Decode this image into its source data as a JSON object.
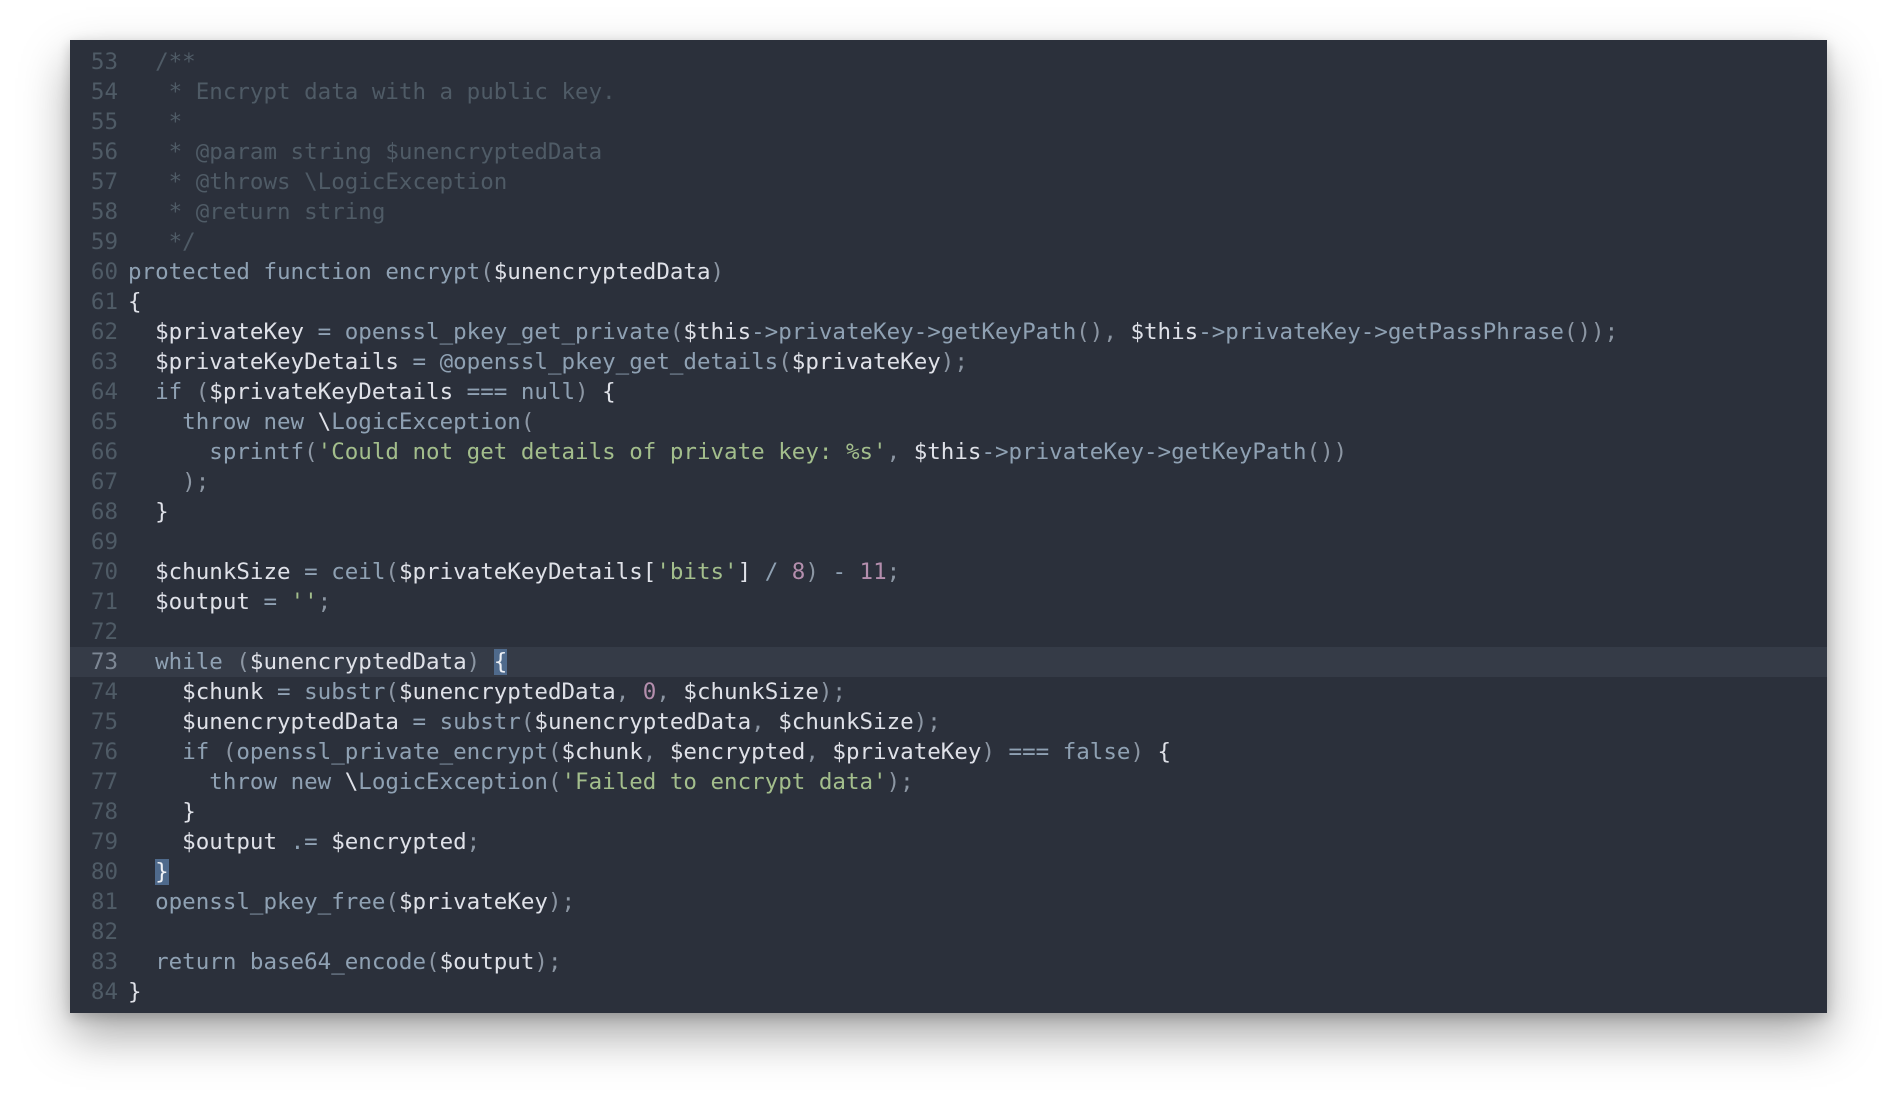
{
  "editor": {
    "colors": {
      "background": "#2b303b",
      "active_line": "#353b47",
      "bracket_match": "#4f6a8c",
      "comment": "#4f5b66",
      "keyword": "#8fa1b3",
      "string": "#a3be8c",
      "number": "#b48ead",
      "variable": "#dfe1e8"
    },
    "active_line_number": "73",
    "lines": [
      {
        "n": "53",
        "tokens": [
          [
            "cm",
            "  /**"
          ]
        ]
      },
      {
        "n": "54",
        "tokens": [
          [
            "cm",
            "   * Encrypt data with a public key."
          ]
        ]
      },
      {
        "n": "55",
        "tokens": [
          [
            "cm",
            "   *"
          ]
        ]
      },
      {
        "n": "56",
        "tokens": [
          [
            "cm",
            "   * @param string $unencryptedData"
          ]
        ]
      },
      {
        "n": "57",
        "tokens": [
          [
            "cm",
            "   * @throws \\LogicException"
          ]
        ]
      },
      {
        "n": "58",
        "tokens": [
          [
            "cm",
            "   * @return string"
          ]
        ]
      },
      {
        "n": "59",
        "tokens": [
          [
            "cm",
            "   */"
          ]
        ]
      },
      {
        "n": "60",
        "tokens": [
          [
            "kw",
            "protected"
          ],
          [
            "vr",
            " "
          ],
          [
            "kw",
            "function"
          ],
          [
            "vr",
            " "
          ],
          [
            "fn",
            "encrypt"
          ],
          [
            "pu",
            "("
          ],
          [
            "vr",
            "$unencryptedData"
          ],
          [
            "pu",
            ")"
          ]
        ]
      },
      {
        "n": "61",
        "tokens": [
          [
            "br",
            "{"
          ]
        ]
      },
      {
        "n": "62",
        "tokens": [
          [
            "vr",
            "  $privateKey "
          ],
          [
            "op",
            "="
          ],
          [
            "vr",
            " "
          ],
          [
            "fn",
            "openssl_pkey_get_private"
          ],
          [
            "pu",
            "("
          ],
          [
            "vr",
            "$this"
          ],
          [
            "op",
            "->"
          ],
          [
            "fn",
            "privateKey"
          ],
          [
            "op",
            "->"
          ],
          [
            "fn",
            "getKeyPath"
          ],
          [
            "pu",
            "(), "
          ],
          [
            "vr",
            "$this"
          ],
          [
            "op",
            "->"
          ],
          [
            "fn",
            "privateKey"
          ],
          [
            "op",
            "->"
          ],
          [
            "fn",
            "getPassPhrase"
          ],
          [
            "pu",
            "());"
          ]
        ]
      },
      {
        "n": "63",
        "tokens": [
          [
            "vr",
            "  $privateKeyDetails "
          ],
          [
            "op",
            "="
          ],
          [
            "vr",
            " "
          ],
          [
            "op",
            "@"
          ],
          [
            "fn",
            "openssl_pkey_get_details"
          ],
          [
            "pu",
            "("
          ],
          [
            "vr",
            "$privateKey"
          ],
          [
            "pu",
            ");"
          ]
        ]
      },
      {
        "n": "64",
        "tokens": [
          [
            "vr",
            "  "
          ],
          [
            "kw",
            "if"
          ],
          [
            "vr",
            " "
          ],
          [
            "pu",
            "("
          ],
          [
            "vr",
            "$privateKeyDetails "
          ],
          [
            "op",
            "==="
          ],
          [
            "vr",
            " "
          ],
          [
            "kw",
            "null"
          ],
          [
            "pu",
            ")"
          ],
          [
            "vr",
            " "
          ],
          [
            "br",
            "{"
          ]
        ]
      },
      {
        "n": "65",
        "tokens": [
          [
            "vr",
            "    "
          ],
          [
            "kw",
            "throw"
          ],
          [
            "vr",
            " "
          ],
          [
            "kw",
            "new"
          ],
          [
            "vr",
            " \\"
          ],
          [
            "fn",
            "LogicException"
          ],
          [
            "pu",
            "("
          ]
        ]
      },
      {
        "n": "66",
        "tokens": [
          [
            "vr",
            "      "
          ],
          [
            "fn",
            "sprintf"
          ],
          [
            "pu",
            "("
          ],
          [
            "st",
            "'Could not get details of private key: %s'"
          ],
          [
            "pu",
            ", "
          ],
          [
            "vr",
            "$this"
          ],
          [
            "op",
            "->"
          ],
          [
            "fn",
            "privateKey"
          ],
          [
            "op",
            "->"
          ],
          [
            "fn",
            "getKeyPath"
          ],
          [
            "pu",
            "())"
          ]
        ]
      },
      {
        "n": "67",
        "tokens": [
          [
            "vr",
            "    "
          ],
          [
            "pu",
            ");"
          ]
        ]
      },
      {
        "n": "68",
        "tokens": [
          [
            "vr",
            "  "
          ],
          [
            "br",
            "}"
          ]
        ]
      },
      {
        "n": "69",
        "tokens": []
      },
      {
        "n": "70",
        "tokens": [
          [
            "vr",
            "  $chunkSize "
          ],
          [
            "op",
            "="
          ],
          [
            "vr",
            " "
          ],
          [
            "fn",
            "ceil"
          ],
          [
            "pu",
            "("
          ],
          [
            "vr",
            "$privateKeyDetails["
          ],
          [
            "st",
            "'bits'"
          ],
          [
            "vr",
            "] "
          ],
          [
            "op",
            "/"
          ],
          [
            "vr",
            " "
          ],
          [
            "nu",
            "8"
          ],
          [
            "pu",
            ")"
          ],
          [
            "vr",
            " "
          ],
          [
            "op",
            "-"
          ],
          [
            "vr",
            " "
          ],
          [
            "nu",
            "11"
          ],
          [
            "pu",
            ";"
          ]
        ]
      },
      {
        "n": "71",
        "tokens": [
          [
            "vr",
            "  $output "
          ],
          [
            "op",
            "="
          ],
          [
            "vr",
            " "
          ],
          [
            "st",
            "''"
          ],
          [
            "pu",
            ";"
          ]
        ]
      },
      {
        "n": "72",
        "tokens": []
      },
      {
        "n": "73",
        "tokens": [
          [
            "vr",
            "  "
          ],
          [
            "kw",
            "while"
          ],
          [
            "vr",
            " "
          ],
          [
            "pu",
            "("
          ],
          [
            "vr",
            "$unencryptedData"
          ],
          [
            "pu",
            ")"
          ],
          [
            "vr",
            " "
          ],
          [
            "hl",
            "{"
          ]
        ]
      },
      {
        "n": "74",
        "tokens": [
          [
            "vr",
            "    $chunk "
          ],
          [
            "op",
            "="
          ],
          [
            "vr",
            " "
          ],
          [
            "fn",
            "substr"
          ],
          [
            "pu",
            "("
          ],
          [
            "vr",
            "$unencryptedData"
          ],
          [
            "pu",
            ", "
          ],
          [
            "nu",
            "0"
          ],
          [
            "pu",
            ", "
          ],
          [
            "vr",
            "$chunkSize"
          ],
          [
            "pu",
            ");"
          ]
        ]
      },
      {
        "n": "75",
        "tokens": [
          [
            "vr",
            "    $unencryptedData "
          ],
          [
            "op",
            "="
          ],
          [
            "vr",
            " "
          ],
          [
            "fn",
            "substr"
          ],
          [
            "pu",
            "("
          ],
          [
            "vr",
            "$unencryptedData"
          ],
          [
            "pu",
            ", "
          ],
          [
            "vr",
            "$chunkSize"
          ],
          [
            "pu",
            ");"
          ]
        ]
      },
      {
        "n": "76",
        "tokens": [
          [
            "vr",
            "    "
          ],
          [
            "kw",
            "if"
          ],
          [
            "vr",
            " "
          ],
          [
            "pu",
            "("
          ],
          [
            "fn",
            "openssl_private_encrypt"
          ],
          [
            "pu",
            "("
          ],
          [
            "vr",
            "$chunk"
          ],
          [
            "pu",
            ", "
          ],
          [
            "vr",
            "$encrypted"
          ],
          [
            "pu",
            ", "
          ],
          [
            "vr",
            "$privateKey"
          ],
          [
            "pu",
            ")"
          ],
          [
            "vr",
            " "
          ],
          [
            "op",
            "==="
          ],
          [
            "vr",
            " "
          ],
          [
            "kw",
            "false"
          ],
          [
            "pu",
            ")"
          ],
          [
            "vr",
            " "
          ],
          [
            "br",
            "{"
          ]
        ]
      },
      {
        "n": "77",
        "tokens": [
          [
            "vr",
            "      "
          ],
          [
            "kw",
            "throw"
          ],
          [
            "vr",
            " "
          ],
          [
            "kw",
            "new"
          ],
          [
            "vr",
            " \\"
          ],
          [
            "fn",
            "LogicException"
          ],
          [
            "pu",
            "("
          ],
          [
            "st",
            "'Failed to encrypt data'"
          ],
          [
            "pu",
            ");"
          ]
        ]
      },
      {
        "n": "78",
        "tokens": [
          [
            "vr",
            "    "
          ],
          [
            "br",
            "}"
          ]
        ]
      },
      {
        "n": "79",
        "tokens": [
          [
            "vr",
            "    $output "
          ],
          [
            "op",
            ".="
          ],
          [
            "vr",
            " $encrypted"
          ],
          [
            "pu",
            ";"
          ]
        ]
      },
      {
        "n": "80",
        "tokens": [
          [
            "vr",
            "  "
          ],
          [
            "hl",
            "}"
          ]
        ]
      },
      {
        "n": "81",
        "tokens": [
          [
            "vr",
            "  "
          ],
          [
            "fn",
            "openssl_pkey_free"
          ],
          [
            "pu",
            "("
          ],
          [
            "vr",
            "$privateKey"
          ],
          [
            "pu",
            ");"
          ]
        ]
      },
      {
        "n": "82",
        "tokens": []
      },
      {
        "n": "83",
        "tokens": [
          [
            "vr",
            "  "
          ],
          [
            "kw",
            "return"
          ],
          [
            "vr",
            " "
          ],
          [
            "fn",
            "base64_encode"
          ],
          [
            "pu",
            "("
          ],
          [
            "vr",
            "$output"
          ],
          [
            "pu",
            ");"
          ]
        ]
      },
      {
        "n": "84",
        "tokens": [
          [
            "br",
            "}"
          ]
        ]
      }
    ]
  }
}
